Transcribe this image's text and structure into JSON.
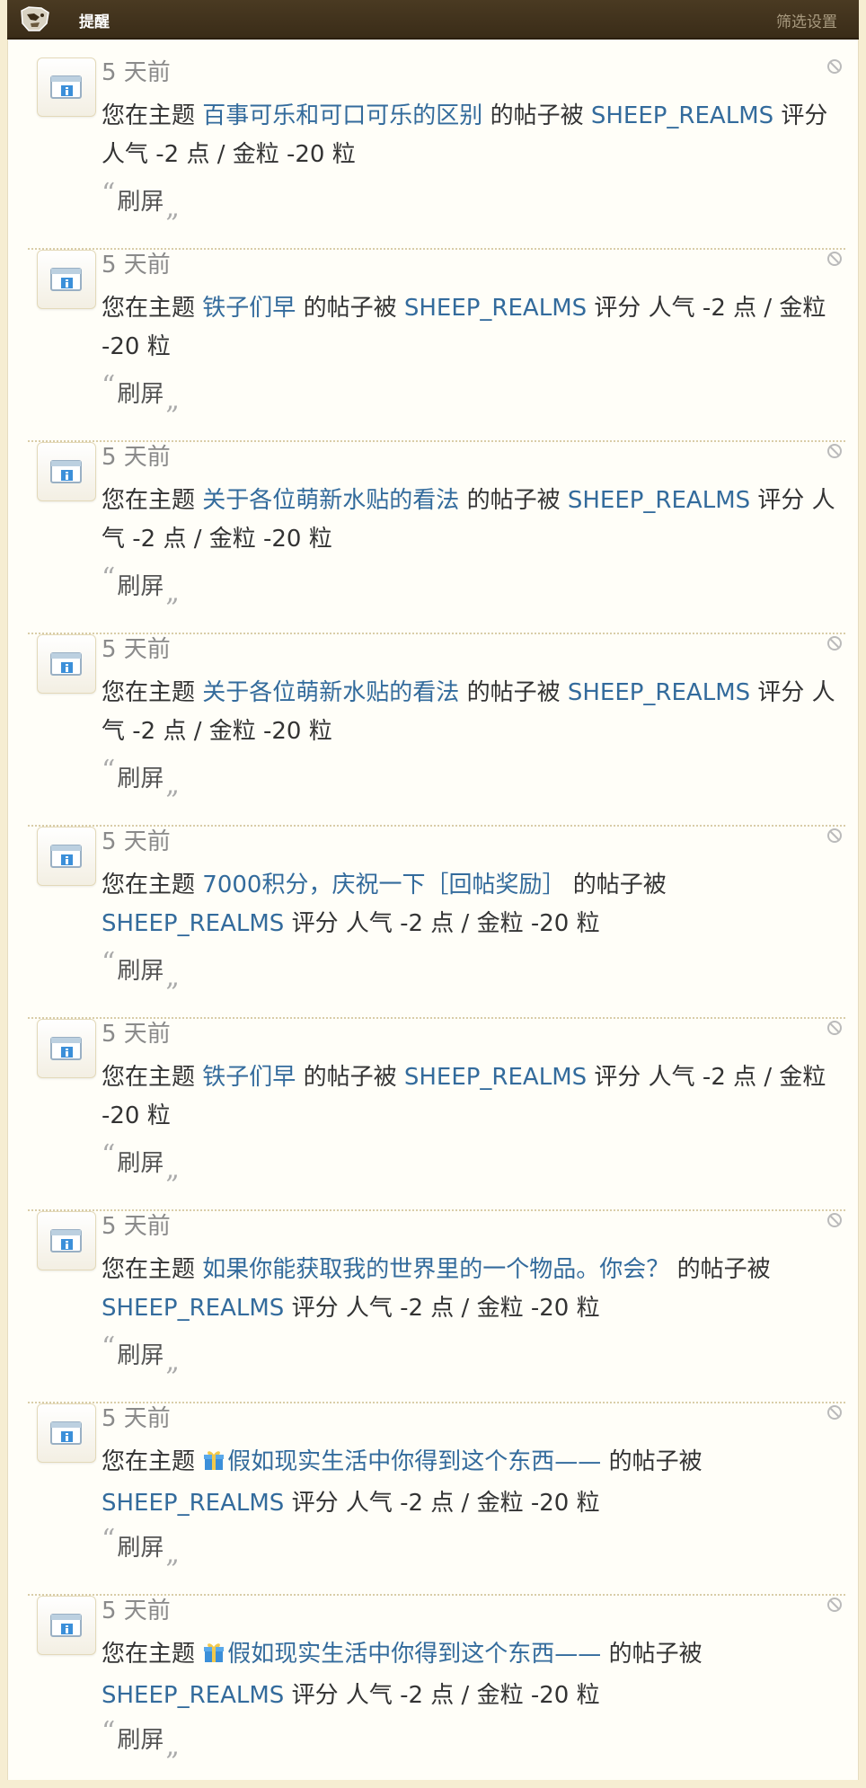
{
  "header": {
    "title": "提醒",
    "filter_label": "筛选设置"
  },
  "notifications": [
    {
      "time": "5 天前",
      "prefix": "您在主题",
      "topic": "百事可乐和可口可乐的区别",
      "mid": "的帖子被",
      "user": "SHEEP_REALMS",
      "rating": "评分 人气 -2 点 / 金粒 -20 粒",
      "reason": "刷屏"
    },
    {
      "time": "5 天前",
      "prefix": "您在主题",
      "topic": "铁子们早",
      "mid": "的帖子被",
      "user": "SHEEP_REALMS",
      "rating": "评分 人气 -2 点 / 金粒 -20 粒",
      "reason": "刷屏"
    },
    {
      "time": "5 天前",
      "prefix": "您在主题",
      "topic": "关于各位萌新水贴的看法",
      "mid": "的帖子被",
      "user": "SHEEP_REALMS",
      "rating": "评分 人气 -2 点 / 金粒 -20 粒",
      "reason": "刷屏"
    },
    {
      "time": "5 天前",
      "prefix": "您在主题",
      "topic": "关于各位萌新水贴的看法",
      "mid": "的帖子被",
      "user": "SHEEP_REALMS",
      "rating": "评分 人气 -2 点 / 金粒 -20 粒",
      "reason": "刷屏"
    },
    {
      "time": "5 天前",
      "prefix": "您在主题",
      "topic": "7000积分，庆祝一下［回帖奖励］",
      "mid": "的帖子被",
      "user": "SHEEP_REALMS",
      "rating": "评分 人气 -2 点 / 金粒 -20 粒",
      "reason": "刷屏"
    },
    {
      "time": "5 天前",
      "prefix": "您在主题",
      "topic": "铁子们早",
      "mid": "的帖子被",
      "user": "SHEEP_REALMS",
      "rating": "评分 人气 -2 点 / 金粒 -20 粒",
      "reason": "刷屏"
    },
    {
      "time": "5 天前",
      "prefix": "您在主题",
      "topic": "如果你能获取我的世界里的一个物品。你会？",
      "mid": "的帖子被",
      "user": "SHEEP_REALMS",
      "rating": "评分 人气 -2 点 / 金粒 -20 粒",
      "reason": "刷屏"
    },
    {
      "time": "5 天前",
      "prefix": "您在主题",
      "topic": "假如现实生活中你得到这个东西——",
      "mid": "的帖子被",
      "user": "SHEEP_REALMS",
      "rating": "评分 人气 -2 点 / 金粒 -20 粒",
      "reason": "刷屏",
      "icon": "gift-icon"
    },
    {
      "time": "5 天前",
      "prefix": "您在主题",
      "topic": "假如现实生活中你得到这个东西——",
      "mid": "的帖子被",
      "user": "SHEEP_REALMS",
      "rating": "评分 人气 -2 点 / 金粒 -20 粒",
      "reason": "刷屏",
      "icon": "gift-icon"
    }
  ]
}
